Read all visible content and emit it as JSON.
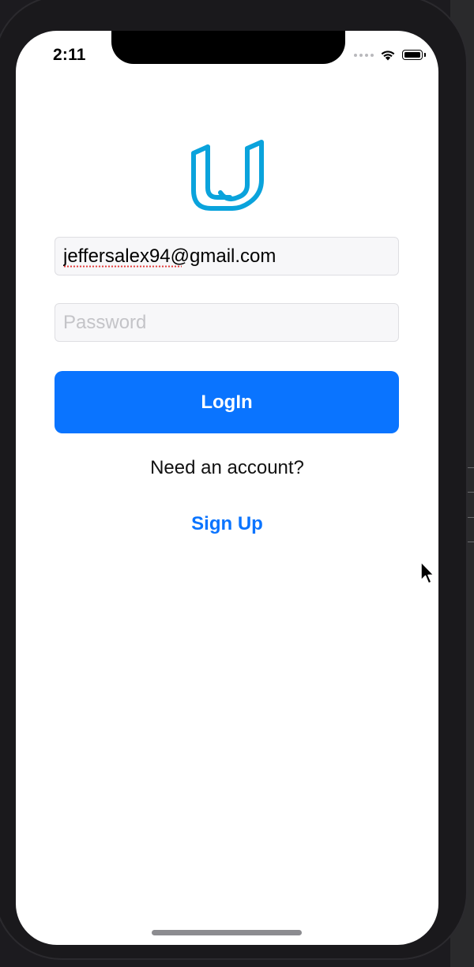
{
  "status_bar": {
    "time": "2:11",
    "icons": [
      "cellular-signal-icon",
      "wifi-icon",
      "battery-icon"
    ]
  },
  "logo": {
    "icon": "udacity-logo-icon",
    "color": "#0aa3dc"
  },
  "login_form": {
    "email": {
      "value": "jeffersalex94@gmail.com",
      "spellcheck_flagged_text": "jeffersalex94"
    },
    "password": {
      "value": "",
      "placeholder": "Password"
    },
    "login_button_label": "LogIn",
    "need_account_text": "Need an account?",
    "signup_label": "Sign Up"
  },
  "colors": {
    "primary": "#0a74ff",
    "field_background": "#f7f7f9",
    "field_border": "#dedee2",
    "placeholder": "#c4c4c8",
    "device_frame": "#1a191c"
  }
}
